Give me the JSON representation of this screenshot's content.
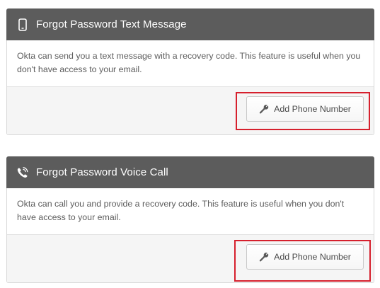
{
  "sections": [
    {
      "title": "Forgot Password Text Message",
      "icon": "phone-icon",
      "description": "Okta can send you a text message with a recovery code. This feature is useful when you don't have access to your email.",
      "button_label": "Add Phone Number",
      "button_icon": "wrench-icon"
    },
    {
      "title": "Forgot Password Voice Call",
      "icon": "voice-call-icon",
      "description": "Okta can call you and provide a recovery code. This feature is useful when you don't have access to your email.",
      "button_label": "Add Phone Number",
      "button_icon": "wrench-icon"
    }
  ],
  "colors": {
    "header_bg": "#5c5c5c",
    "footer_bg": "#f5f5f5",
    "highlight": "#d6202d"
  }
}
